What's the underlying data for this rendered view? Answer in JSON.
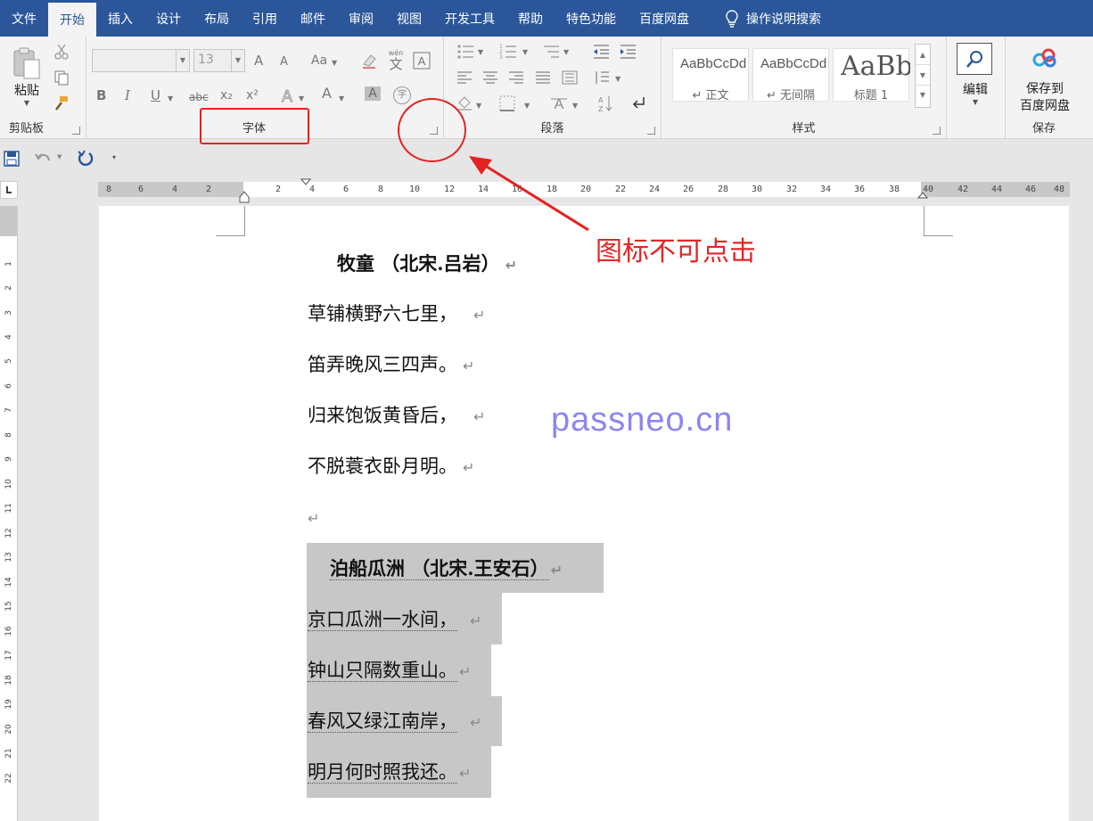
{
  "tabs": [
    {
      "label": "文件",
      "active": false
    },
    {
      "label": "开始",
      "active": true
    },
    {
      "label": "插入",
      "active": false
    },
    {
      "label": "设计",
      "active": false
    },
    {
      "label": "布局",
      "active": false
    },
    {
      "label": "引用",
      "active": false
    },
    {
      "label": "邮件",
      "active": false
    },
    {
      "label": "审阅",
      "active": false
    },
    {
      "label": "视图",
      "active": false
    },
    {
      "label": "开发工具",
      "active": false
    },
    {
      "label": "帮助",
      "active": false
    },
    {
      "label": "特色功能",
      "active": false
    },
    {
      "label": "百度网盘",
      "active": false
    }
  ],
  "search": {
    "label": "操作说明搜索",
    "icon": "lightbulb-icon"
  },
  "ribbon": {
    "clipboard": {
      "paste_label": "粘贴",
      "group_label": "剪贴板"
    },
    "font": {
      "size_value": "13",
      "group_label": "字体",
      "change_case": "Aa",
      "grow": "A",
      "shrink": "A",
      "bold": "B",
      "italic": "I",
      "underline": "U",
      "strike": "abc",
      "subscript": "x₂",
      "superscript": "x²",
      "font_color": "A",
      "char_shade": "A",
      "phonetic": "文",
      "phonetic_top": "wén",
      "enclose": "字"
    },
    "paragraph": {
      "group_label": "段落"
    },
    "styles": {
      "group_label": "样式",
      "items": [
        {
          "sample": "AaBbCcDd",
          "name": "↵ 正文"
        },
        {
          "sample": "AaBbCcDd",
          "name": "↵ 无间隔"
        },
        {
          "sample": "AaBb",
          "name": "标题 1"
        }
      ]
    },
    "editing": {
      "label": "编辑"
    },
    "save": {
      "label": "保存到百度网盘",
      "line1": "保存到",
      "line2": "百度网盘",
      "group_label": "保存"
    }
  },
  "ruler": {
    "left_labels": [
      "8",
      "6",
      "4",
      "2"
    ],
    "labels": [
      "2",
      "4",
      "6",
      "8",
      "10",
      "12",
      "14",
      "16",
      "18",
      "20",
      "22",
      "24",
      "26",
      "28",
      "30",
      "32",
      "34",
      "36",
      "38",
      "40",
      "42",
      "44",
      "46",
      "48"
    ],
    "vertical": [
      "1",
      "2",
      "3",
      "4",
      "5",
      "6",
      "7",
      "8",
      "9",
      "10",
      "11",
      "12",
      "13",
      "14",
      "15",
      "16",
      "17",
      "18",
      "19",
      "20",
      "21",
      "22"
    ]
  },
  "document": {
    "lines": [
      {
        "text": "牧童 （北宋.吕岩）",
        "style": "title",
        "highlight": false
      },
      {
        "text": "草铺横野六七里，",
        "style": "body",
        "highlight": false
      },
      {
        "text": "笛弄晚风三四声。",
        "style": "body",
        "highlight": false
      },
      {
        "text": "归来饱饭黄昏后，",
        "style": "body",
        "highlight": false
      },
      {
        "text": "不脱蓑衣卧月明。",
        "style": "body",
        "highlight": false
      },
      {
        "text": "",
        "style": "body",
        "highlight": false
      },
      {
        "text": "泊船瓜洲 （北宋.王安石）",
        "style": "title",
        "highlight": true
      },
      {
        "text": "京口瓜洲一水间，",
        "style": "body",
        "highlight": true
      },
      {
        "text": "钟山只隔数重山。",
        "style": "body",
        "highlight": true
      },
      {
        "text": "春风又绿江南岸，",
        "style": "body",
        "highlight": true
      },
      {
        "text": "明月何时照我还。",
        "style": "body",
        "highlight": true
      }
    ],
    "return_mark": "↵"
  },
  "watermark": "passneo.cn",
  "annotation": {
    "note": "图标不可点击",
    "color": "#e52222"
  },
  "colors": {
    "accent": "#2b579a",
    "highlight": "#c7c7c7",
    "watermark": "#8c86f0"
  }
}
